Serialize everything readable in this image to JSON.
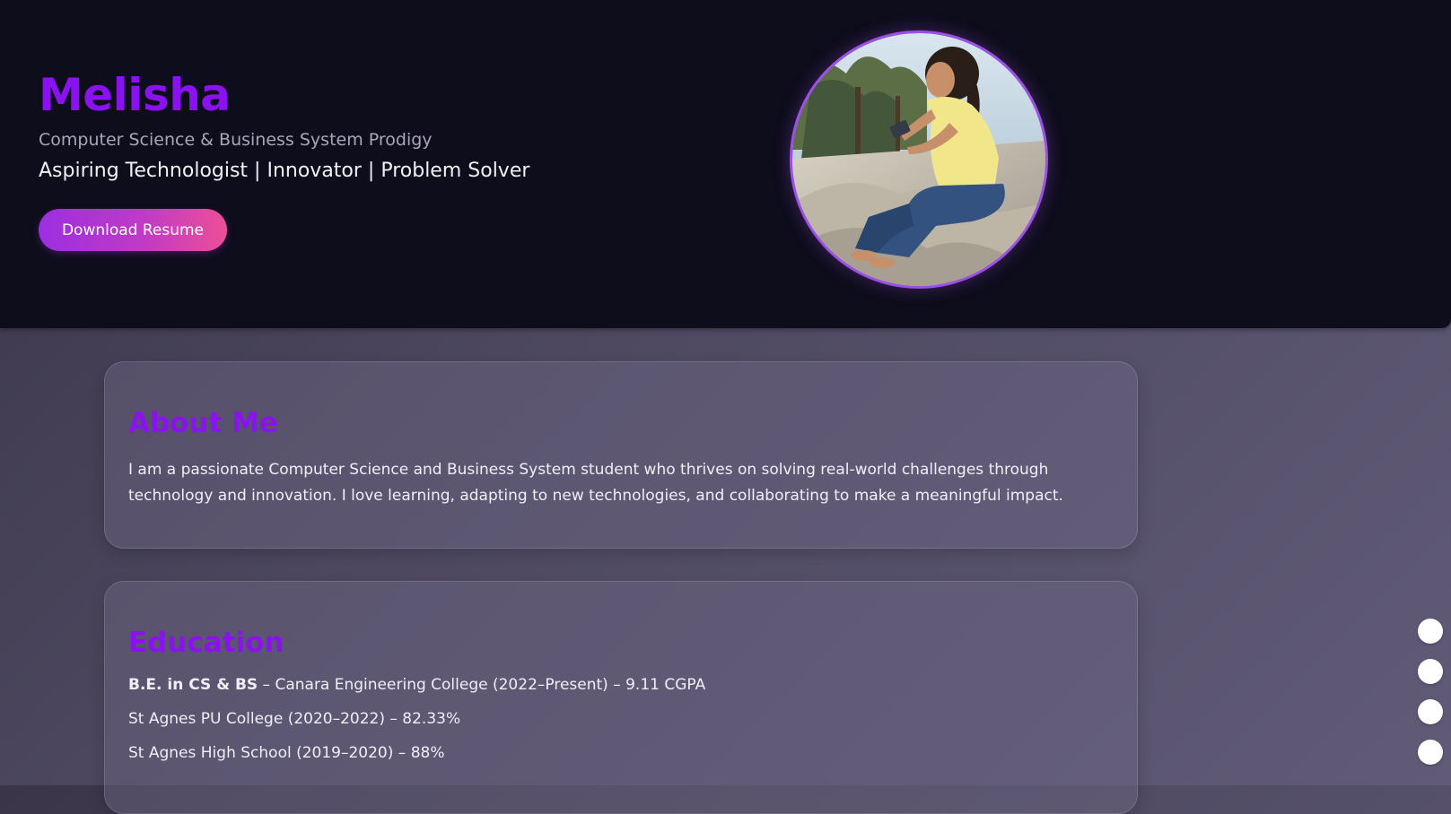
{
  "hero": {
    "name": "Melisha",
    "subtitle": "Computer Science & Business System Prodigy",
    "tagline": "Aspiring Technologist | Innovator | Problem Solver",
    "resume_button": "Download Resume"
  },
  "about": {
    "title": "About Me",
    "text": "I am a passionate Computer Science and Business System student who thrives on solving real-world challenges through technology and innovation. I love learning, adapting to new technologies, and collaborating to make a meaningful impact."
  },
  "education": {
    "title": "Education",
    "items": [
      {
        "degree": "B.E. in CS & BS",
        "details": " – Canara Engineering College (2022–Present) – 9.11 CGPA"
      },
      {
        "details": "St Agnes PU College (2020–2022) – 82.33%"
      },
      {
        "details": "St Agnes High School (2019–2020) – 88%"
      }
    ]
  },
  "nav_dots": {
    "count": 4
  },
  "colors": {
    "accent": "#8b12f0",
    "hero_bg": "#0e0d1c",
    "button_gradient_start": "#9b2fe0",
    "button_gradient_end": "#ec4f96",
    "avatar_border": "#9d4fe6"
  }
}
